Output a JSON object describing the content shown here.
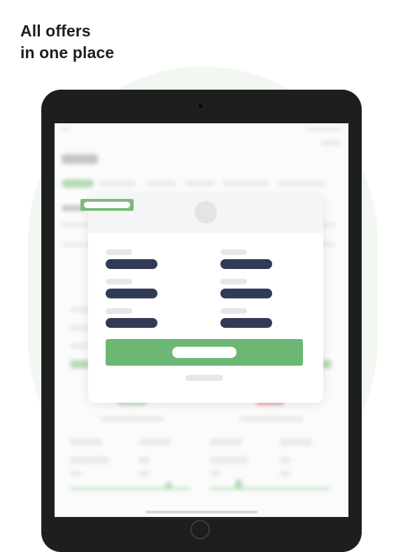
{
  "headline": {
    "line1": "All offers",
    "line2": "in one place"
  },
  "colors": {
    "accent_green": "#6db775",
    "badge_green": "#7dbb7a",
    "value_bar_navy": "#323b55",
    "device_frame": "#1d1f1f",
    "background_tint": "#f2f8f1"
  },
  "device": {
    "type": "tablet"
  },
  "modal": {
    "rows": 3,
    "columns": 2
  }
}
